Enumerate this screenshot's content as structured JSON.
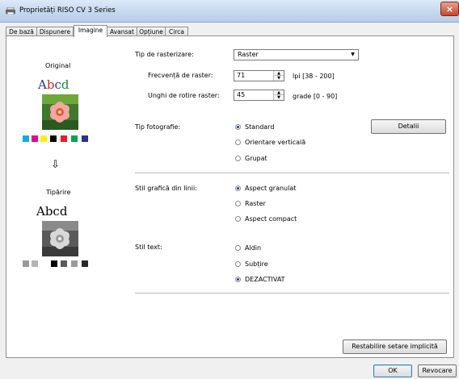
{
  "window": {
    "title": "Proprietăți RISO CV 3 Series",
    "close_glyph": "×"
  },
  "tabs": [
    {
      "label": "De bază"
    },
    {
      "label": "Dispunere"
    },
    {
      "label": "Imagine"
    },
    {
      "label": "Avansat"
    },
    {
      "label": "Opțiune"
    },
    {
      "label": "Circa"
    }
  ],
  "active_tab": "Imagine",
  "preview": {
    "original_label": "Original",
    "original_text": [
      "A",
      "b",
      "c",
      "d"
    ],
    "original_text_colors": [
      "#1e3a8a",
      "#d02020",
      "#1e3a8a",
      "#1a8a2a"
    ],
    "color_swatches": [
      "#00aeef",
      "#ec008c",
      "#fff200",
      "#000000",
      "#ed1c24",
      "#00a651",
      "#2e3192"
    ],
    "arrow_glyph": "⇩",
    "print_label": "Tipărire",
    "print_text": "Abcd",
    "gray_swatches": [
      "#9a9a9a",
      "#b4b4b4",
      "#ffffff",
      "#000000",
      "#5a5a5a",
      "#9a9a9a",
      "#282828"
    ]
  },
  "screen": {
    "type_label": "Tip de rasterizare:",
    "type_value": "Raster",
    "freq_label": "Frecvență de raster:",
    "freq_value": "71",
    "freq_unit": "lpi [38 - 200]",
    "angle_label": "Unghi de rotire raster:",
    "angle_value": "45",
    "angle_unit": "grade [0 - 90]"
  },
  "photo": {
    "label": "Tip fotografie:",
    "options": [
      "Standard",
      "Orientare verticală",
      "Grupat"
    ],
    "selected": "Standard",
    "details_button": "Detalii"
  },
  "line_art": {
    "label": "Stil grafică din linii:",
    "options": [
      "Aspect granulat",
      "Raster",
      "Aspect compact"
    ],
    "selected": "Aspect granulat"
  },
  "text_style": {
    "label": "Stil text:",
    "options": [
      "Aldin",
      "Subțire",
      "DEZACTIVAT"
    ],
    "selected": "DEZACTIVAT"
  },
  "restore_button": "Restabilire setare implicită",
  "footer": {
    "ok": "OK",
    "cancel": "Revocare"
  }
}
